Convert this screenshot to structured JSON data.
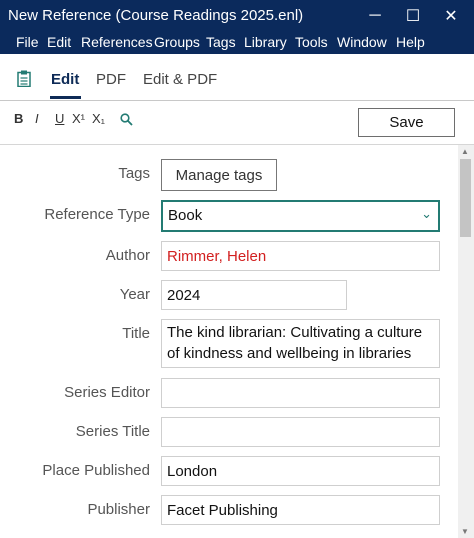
{
  "window": {
    "title": "New Reference (Course Readings 2025.enl)",
    "minimize": "─",
    "maximize": "☐",
    "close": "✕"
  },
  "menu": [
    "File",
    "Edit",
    "References",
    "Groups",
    "Tags",
    "Library",
    "Tools",
    "Window",
    "Help"
  ],
  "tabs": {
    "edit": "Edit",
    "pdf": "PDF",
    "edit_pdf": "Edit & PDF"
  },
  "toolbar": {
    "bold": "B",
    "italic": "I",
    "underline": "U",
    "superscript": "X¹",
    "subscript": "X₁",
    "save": "Save"
  },
  "form": {
    "tags_label": "Tags",
    "manage_tags": "Manage tags",
    "reference_type_label": "Reference Type",
    "reference_type_value": "Book",
    "author_label": "Author",
    "author_value": "Rimmer, Helen",
    "year_label": "Year",
    "year_value": "2024",
    "title_label": "Title",
    "title_value": "The kind librarian: Cultivating a culture of kindness and wellbeing in libraries",
    "series_editor_label": "Series Editor",
    "series_editor_value": "",
    "series_title_label": "Series Title",
    "series_title_value": "",
    "place_published_label": "Place Published",
    "place_published_value": "London",
    "publisher_label": "Publisher",
    "publisher_value": "Facet Publishing"
  },
  "colors": {
    "titlebar_bg": "#0b2a5c",
    "accent_teal": "#237b73",
    "author_red": "#d22020"
  }
}
